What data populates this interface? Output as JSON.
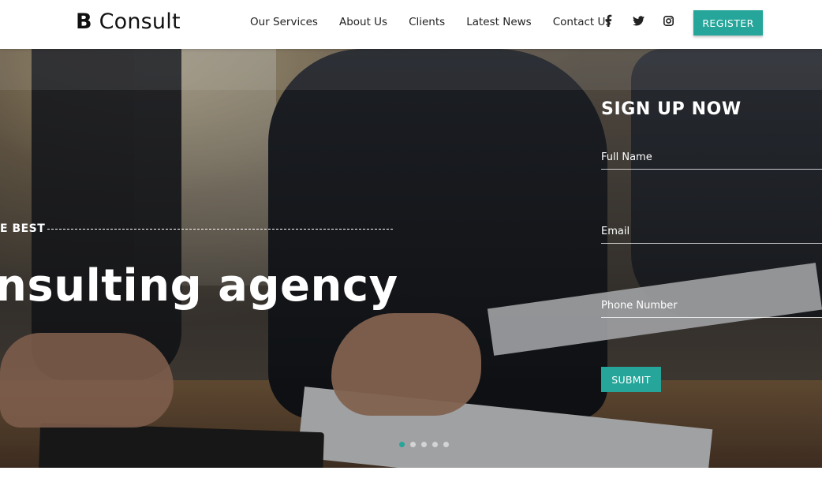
{
  "brand": {
    "logo_bold": "B",
    "logo_rest": "Consult"
  },
  "nav": {
    "items": [
      {
        "label": "Our Services"
      },
      {
        "label": "About Us"
      },
      {
        "label": "Clients"
      },
      {
        "label": "Latest News"
      },
      {
        "label": "Contact Us"
      }
    ]
  },
  "social": {
    "icons": [
      "facebook-icon",
      "twitter-icon",
      "instagram-icon"
    ]
  },
  "header": {
    "register_label": "REGISTER"
  },
  "hero": {
    "tagline": "E BEST",
    "headline": "nsulting agency",
    "slides": {
      "count": 5,
      "active_index": 0
    }
  },
  "signup": {
    "title": "SIGN UP NOW",
    "full_name_placeholder": "Full Name",
    "email_placeholder": "Email",
    "phone_placeholder": "Phone Number",
    "submit_label": "SUBMIT"
  },
  "colors": {
    "accent": "#26a69a",
    "text_dark": "#222222",
    "white": "#ffffff"
  }
}
